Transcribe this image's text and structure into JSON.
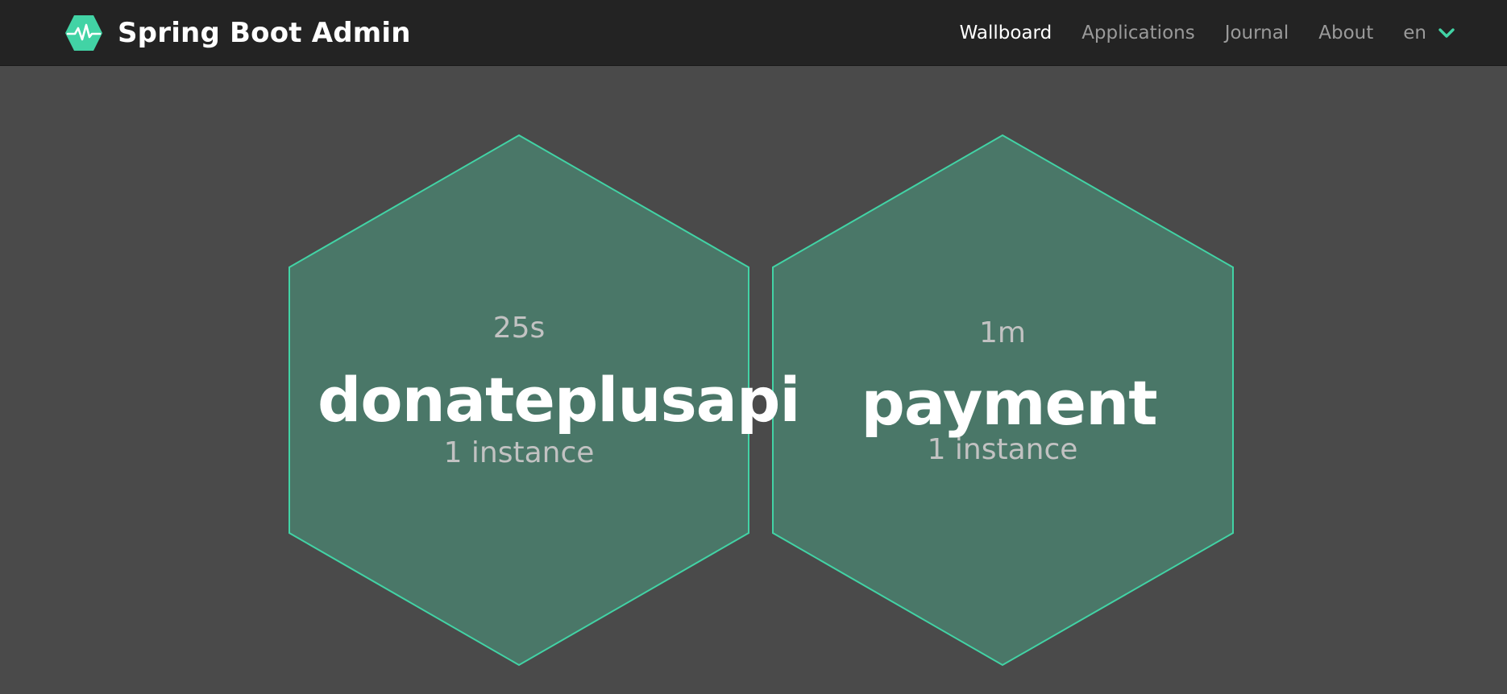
{
  "navbar": {
    "brand_title": "Spring Boot Admin",
    "brand_logo_icon": "heartbeat-hexagon-icon",
    "items": [
      {
        "label": "Wallboard",
        "active": true
      },
      {
        "label": "Applications",
        "active": false
      },
      {
        "label": "Journal",
        "active": false
      },
      {
        "label": "About",
        "active": false
      }
    ],
    "language": {
      "label": "en",
      "icon": "chevron-down-icon"
    }
  },
  "applications": [
    {
      "name": "donateplusapi",
      "since": "25s",
      "instances": "1 instance",
      "status_color": "#42d3a5"
    },
    {
      "name": "payment",
      "since": "1m",
      "instances": "1 instance",
      "status_color": "#42d3a5"
    }
  ],
  "colors": {
    "navbar_bg": "#232323",
    "page_bg": "#4a4a4a",
    "accent": "#42d3a5",
    "hex_fill": "#4a7768"
  }
}
